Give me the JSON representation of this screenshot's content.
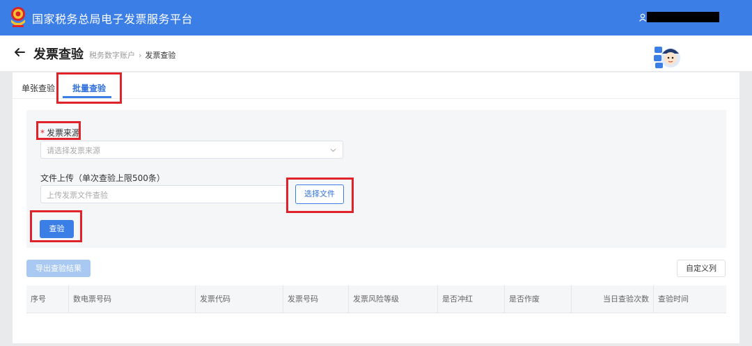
{
  "app": {
    "title": "国家税务总局电子发票服务平台"
  },
  "header": {
    "title": "发票查验",
    "breadcrumb": [
      "税务数字账户",
      "发票查验"
    ]
  },
  "tabs": [
    {
      "label": "单张查验",
      "active": false
    },
    {
      "label": "批量查验",
      "active": true
    }
  ],
  "form": {
    "source": {
      "required_mark": "*",
      "label": "发票来源",
      "placeholder": "请选择发票来源"
    },
    "upload": {
      "label": "文件上传（单次查验上限500条）",
      "placeholder": "上传发票文件查验",
      "button": "选择文件"
    },
    "verify_button": "查验"
  },
  "toolbar": {
    "export_label": "导出查验结果",
    "custom_columns_label": "自定义列"
  },
  "table": {
    "columns": [
      "序号",
      "数电票号码",
      "发票代码",
      "发票号码",
      "发票风险等级",
      "是否冲红",
      "是否作废",
      "当日查验次数",
      "查验时间"
    ]
  },
  "colors": {
    "primary": "#3a7ee6",
    "highlight": "#e0232b",
    "required": "#e0232b"
  }
}
